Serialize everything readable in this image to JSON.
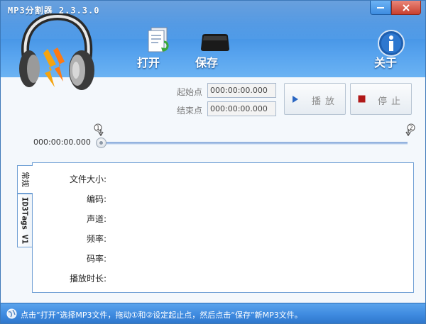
{
  "window": {
    "title": "MP3分割器 2.3.3.0"
  },
  "toolbar": {
    "open_label": "打开",
    "save_label": "保存",
    "about_label": "关于"
  },
  "times": {
    "start_label": "起始点",
    "start_value": "000:00:00.000",
    "end_label": "结束点",
    "end_value": "000:00:00.000",
    "play_label": "播放",
    "stop_label": "停止"
  },
  "slider": {
    "current_time": "000:00:00.000",
    "position": 0
  },
  "tabs": [
    {
      "label": "常规"
    },
    {
      "label": "ID3Tags V1"
    }
  ],
  "info": {
    "fields": [
      {
        "label": "文件大小:"
      },
      {
        "label": "编码:"
      },
      {
        "label": "声道:"
      },
      {
        "label": "频率:"
      },
      {
        "label": "码率:"
      },
      {
        "label": "播放时长:"
      }
    ]
  },
  "status": {
    "text": "点击“打开”选择MP3文件，拖动①和②设定起止点，然后点击“保存”新MP3文件。"
  },
  "colors": {
    "header": "#3a8be0",
    "border": "#6f9fd4",
    "stop_red": "#b01818",
    "play_blue": "#2a66c2"
  },
  "icons": [
    "minimize-icon",
    "close-icon",
    "headphones-logo",
    "open-file-icon",
    "save-disk-icon",
    "info-icon",
    "play-icon",
    "stop-icon",
    "marker-1-icon",
    "marker-2-icon",
    "globe-icon"
  ]
}
